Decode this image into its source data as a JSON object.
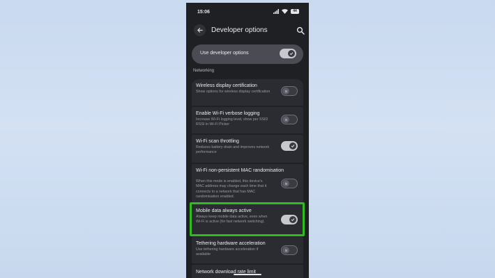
{
  "status_bar": {
    "time": "15:06",
    "battery": "44"
  },
  "header": {
    "title": "Developer options"
  },
  "master_toggle": {
    "label": "Use developer options",
    "state": "on"
  },
  "section": {
    "title": "Networking"
  },
  "settings": [
    {
      "title": "Wireless display certification",
      "description": "Show options for wireless display certification",
      "state": "off"
    },
    {
      "title": "Enable Wi-Fi verbose logging",
      "description": "Increase Wi-Fi logging level, show per SSID RSSI in Wi-Fi Picker",
      "state": "off"
    },
    {
      "title": "Wi-Fi scan throttling",
      "description": "Reduces battery drain and improves network performance",
      "state": "on"
    },
    {
      "title": "Wi-Fi non-persistent MAC randomisation",
      "description": "When this mode is enabled, this device's MAC address may change each time that it connects to a network that has MAC randomisation enabled.",
      "state": "off"
    },
    {
      "title": "Mobile data always active",
      "description": "Always keep mobile data active, even when Wi-Fi is active (for fast network switching).",
      "state": "on"
    },
    {
      "title": "Tethering hardware acceleration",
      "description": "Use tethering hardware acceleration if available",
      "state": "off"
    },
    {
      "title": "Network download rate limit"
    }
  ],
  "highlight_color": "#2ebd1a"
}
